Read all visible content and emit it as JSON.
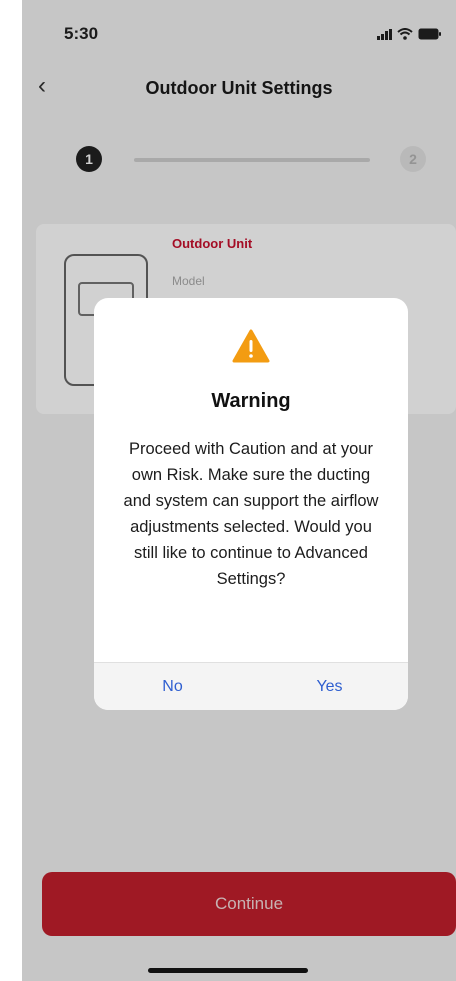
{
  "status": {
    "time": "5:30"
  },
  "nav": {
    "title": "Outdoor Unit Settings",
    "back_icon": "chevron-left-icon"
  },
  "stepper": {
    "current": "1",
    "next": "2"
  },
  "card": {
    "label": "Outdoor Unit",
    "sublabel": "Model"
  },
  "dialog": {
    "title": "Warning",
    "message": "Proceed with Caution and at your own Risk. Make sure the ducting and system can support the airflow adjustments selected. Would you still like to continue to Advanced Settings?",
    "no_label": "No",
    "yes_label": "Yes",
    "icon": "warning-triangle-icon",
    "icon_color": "#f39c12",
    "link_color": "#2f5fd0"
  },
  "footer": {
    "continue_label": "Continue",
    "button_color": "#c21f2c"
  }
}
